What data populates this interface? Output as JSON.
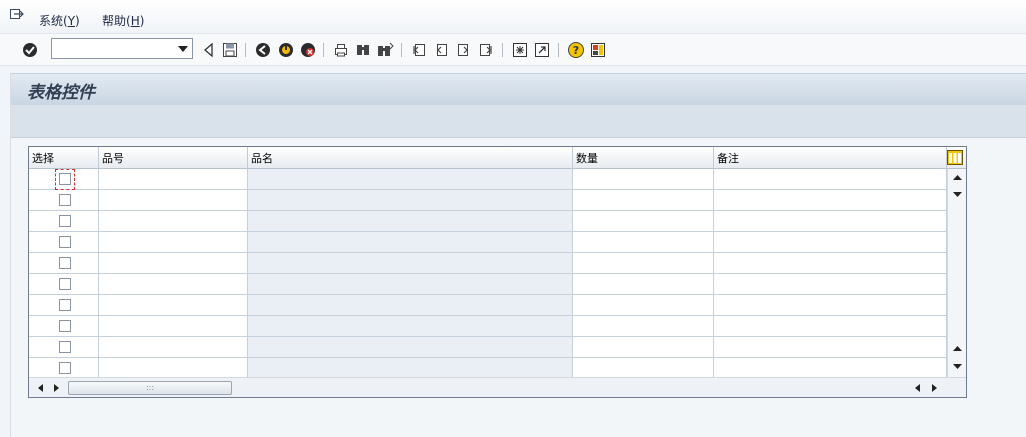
{
  "menubar": {
    "items": [
      {
        "label": "系统(",
        "mnemonic": "Y",
        "end": ")"
      },
      {
        "label": "帮助(",
        "mnemonic": "H",
        "end": ")"
      }
    ]
  },
  "toolbar": {
    "command_field": {
      "value": "",
      "placeholder": ""
    }
  },
  "screen": {
    "title": "表格控件"
  },
  "table": {
    "columns": [
      "选择",
      "品号",
      "品名",
      "数量",
      "备注"
    ],
    "visible_rows": 10,
    "rows": [
      {
        "selected": false,
        "item_no": "",
        "item_name": "",
        "qty": "",
        "remark": ""
      },
      {
        "selected": false,
        "item_no": "",
        "item_name": "",
        "qty": "",
        "remark": ""
      },
      {
        "selected": false,
        "item_no": "",
        "item_name": "",
        "qty": "",
        "remark": ""
      },
      {
        "selected": false,
        "item_no": "",
        "item_name": "",
        "qty": "",
        "remark": ""
      },
      {
        "selected": false,
        "item_no": "",
        "item_name": "",
        "qty": "",
        "remark": ""
      },
      {
        "selected": false,
        "item_no": "",
        "item_name": "",
        "qty": "",
        "remark": ""
      },
      {
        "selected": false,
        "item_no": "",
        "item_name": "",
        "qty": "",
        "remark": ""
      },
      {
        "selected": false,
        "item_no": "",
        "item_name": "",
        "qty": "",
        "remark": ""
      },
      {
        "selected": false,
        "item_no": "",
        "item_name": "",
        "qty": "",
        "remark": ""
      },
      {
        "selected": false,
        "item_no": "",
        "item_name": "",
        "qty": "",
        "remark": ""
      }
    ],
    "hscroll_thumb_glyph": ":::"
  },
  "icons": {
    "enter": "enter-check-icon",
    "back": "back-icon",
    "exit": "exit-icon",
    "cancel": "cancel-icon",
    "save": "save-icon",
    "print": "print-icon",
    "find": "find-icon",
    "find_next": "find-next-icon",
    "first_page": "first-page-icon",
    "prev_page": "previous-page-icon",
    "next_page": "next-page-icon",
    "last_page": "last-page-icon",
    "new_session": "new-session-icon",
    "shortcut": "shortcut-icon",
    "help": "help-icon",
    "layout": "layout-menu-icon"
  },
  "colors": {
    "accent_green": "#2e7d32",
    "exit_yellow": "#f2b707",
    "cancel_red": "#d32f2f",
    "title_text": "#333f52"
  }
}
